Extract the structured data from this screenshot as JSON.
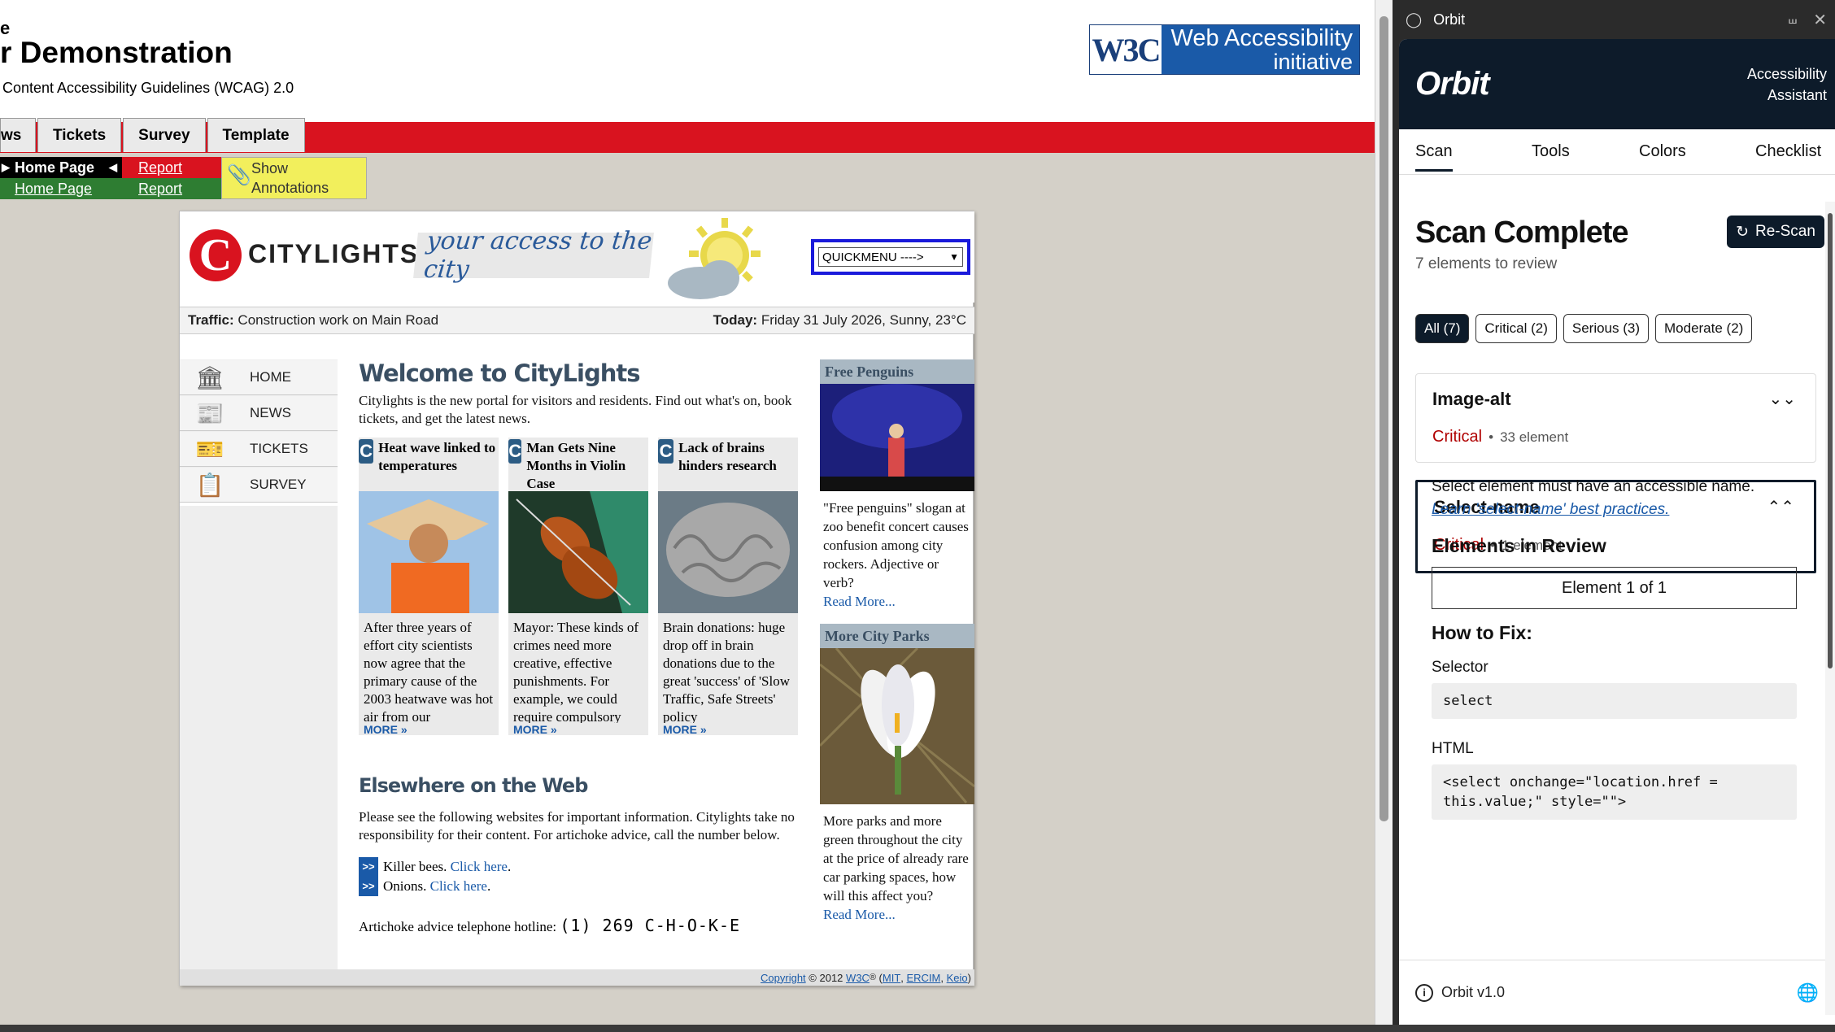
{
  "page": {
    "title_small": "e",
    "title": "r Demonstration",
    "subtitle": "Content Accessibility Guidelines (WCAG) 2.0",
    "wai_logo": {
      "w3c": "W3C",
      "line1": "Web Accessibility",
      "line2": "initiative"
    },
    "nav_tabs": [
      "ws",
      "Tickets",
      "Survey",
      "Template"
    ],
    "toolbar": {
      "home_page": "Home Page",
      "home_page_link": "Home Page",
      "report1": "Report",
      "report2": "Report",
      "annot1": "Show",
      "annot2": "Annotations"
    }
  },
  "city": {
    "logo": "CITYLIGHTS",
    "tagline": "your access to the city",
    "quickmenu": "QUICKMENU ---->",
    "traffic_label": "Traffic:",
    "traffic_text": "Construction work on Main Road",
    "today_label": "Today:",
    "today_text": "Friday 31 July 2026, Sunny, 23°C",
    "side_nav": [
      "HOME",
      "NEWS",
      "TICKETS",
      "SURVEY"
    ],
    "welcome_title": "Welcome to CityLights",
    "welcome_text": "Citylights is the new portal for visitors and residents. Find out what's on, book tickets, and get the latest news.",
    "news": [
      {
        "title": "Heat wave linked to temperatures",
        "text": "After three years of effort city scientists now agree that the primary cause of the 2003 heatwave was hot air from our",
        "more": "MORE"
      },
      {
        "title": "Man Gets Nine Months in Violin Case",
        "text": "Mayor: These kinds of crimes need more creative, effective punishments. For example, we could require compulsory",
        "more": "MORE"
      },
      {
        "title": "Lack of brains hinders research",
        "text": "Brain donations: huge drop off in brain donations due to the great 'success' of 'Slow Traffic, Safe Streets' policy",
        "more": "MORE"
      }
    ],
    "elsewhere_title": "Elsewhere on the Web",
    "elsewhere_text": "Please see the following websites for important information. Citylights take no responsibility for their content. For artichoke advice, call the number below.",
    "links": [
      {
        "label": "Killer bees.",
        "link": "Click here"
      },
      {
        "label": "Onions.",
        "link": "Click here"
      }
    ],
    "hotline_label": "Artichoke advice telephone hotline:",
    "hotline_number": "(1) 269 C-H-O-K-E",
    "penguins_title": "Free Penguins",
    "penguins_text": "\"Free penguins\" slogan at zoo benefit concert causes confusion among city rockers. Adjective or verb?",
    "penguins_more": "Read More...",
    "parks_title": "More City Parks",
    "parks_text": "More parks and more green throughout the city at the price of already rare car parking spaces, how will this affect you?",
    "parks_more": "Read More...",
    "footer": {
      "copyright": "Copyright",
      "year": "© 2012",
      "w3c": "W3C",
      "reg": "®",
      "mit": "MIT",
      "ercim": "ERCIM",
      "keio": "Keio"
    }
  },
  "orbit": {
    "window_title": "Orbit",
    "logo": "Orbit",
    "assistant_line1": "Accessibility",
    "assistant_line2": "Assistant",
    "tabs": [
      "Scan",
      "Tools",
      "Colors",
      "Checklist"
    ],
    "scan_title": "Scan Complete",
    "scan_count": "7 elements to review",
    "rescan": "Re-Scan",
    "filters": [
      "All (7)",
      "Critical (2)",
      "Serious (3)",
      "Moderate (2)"
    ],
    "cards": [
      {
        "title": "Image-alt",
        "severity": "Critical",
        "count": "33 element"
      },
      {
        "title": "Select-name",
        "severity": "Critical",
        "count": "1 element"
      }
    ],
    "details": {
      "description": "Select element must have an accessible name.",
      "learn_link": "Learn 'select-name' best practices.",
      "elements_heading": "Elements in Review",
      "element_pager": "Element 1 of 1",
      "howto_heading": "How to Fix:",
      "selector_label": "Selector",
      "selector_value": "select",
      "html_label": "HTML",
      "html_line1": "<select onchange=\"location.href =",
      "html_line2": "this.value;\" style=\"\">"
    },
    "footer_version": "Orbit v1.0"
  }
}
